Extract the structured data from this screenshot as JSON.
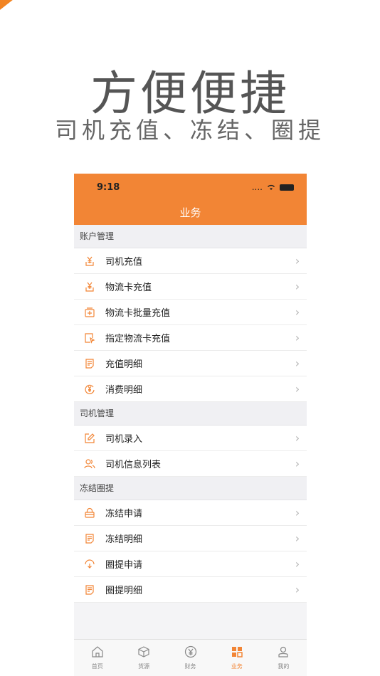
{
  "promo": {
    "headline": "方便便捷",
    "subline": "司机充值、冻结、圈提"
  },
  "status_bar": {
    "time": "9:18",
    "signal": "....",
    "wifi_icon": "wifi-icon",
    "battery_icon": "battery-icon"
  },
  "nav": {
    "title": "业务"
  },
  "sections": [
    {
      "title": "账户管理",
      "items": [
        {
          "label": "司机充值",
          "icon": "yen-download-icon"
        },
        {
          "label": "物流卡充值",
          "icon": "yen-download-icon"
        },
        {
          "label": "物流卡批量充值",
          "icon": "batch-card-icon"
        },
        {
          "label": "指定物流卡充值",
          "icon": "cursor-card-icon"
        },
        {
          "label": "充值明细",
          "icon": "document-icon"
        },
        {
          "label": "消费明细",
          "icon": "yen-circle-icon"
        }
      ]
    },
    {
      "title": "司机管理",
      "items": [
        {
          "label": "司机录入",
          "icon": "edit-icon"
        },
        {
          "label": "司机信息列表",
          "icon": "users-icon"
        }
      ]
    },
    {
      "title": "冻结圈提",
      "items": [
        {
          "label": "冻结申请",
          "icon": "lock-icon"
        },
        {
          "label": "冻结明细",
          "icon": "document-icon"
        },
        {
          "label": "圈提申请",
          "icon": "withdraw-icon"
        },
        {
          "label": "圈提明细",
          "icon": "document-icon"
        }
      ]
    }
  ],
  "tabbar": {
    "items": [
      {
        "label": "首页",
        "icon": "home-icon"
      },
      {
        "label": "货源",
        "icon": "box-icon"
      },
      {
        "label": "财务",
        "icon": "yen-icon"
      },
      {
        "label": "业务",
        "icon": "grid-icon",
        "active": true
      },
      {
        "label": "我的",
        "icon": "profile-icon"
      }
    ]
  },
  "colors": {
    "accent": "#f28535",
    "background": "#f4f4f6"
  }
}
